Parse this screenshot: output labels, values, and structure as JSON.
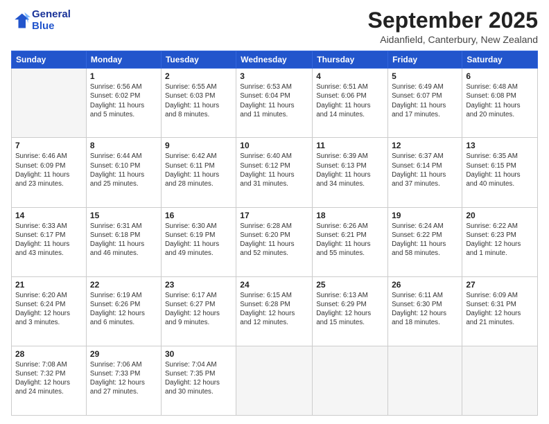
{
  "logo": {
    "line1": "General",
    "line2": "Blue"
  },
  "title": "September 2025",
  "location": "Aidanfield, Canterbury, New Zealand",
  "weekdays": [
    "Sunday",
    "Monday",
    "Tuesday",
    "Wednesday",
    "Thursday",
    "Friday",
    "Saturday"
  ],
  "weeks": [
    [
      {
        "day": "",
        "info": ""
      },
      {
        "day": "1",
        "info": "Sunrise: 6:56 AM\nSunset: 6:02 PM\nDaylight: 11 hours\nand 5 minutes."
      },
      {
        "day": "2",
        "info": "Sunrise: 6:55 AM\nSunset: 6:03 PM\nDaylight: 11 hours\nand 8 minutes."
      },
      {
        "day": "3",
        "info": "Sunrise: 6:53 AM\nSunset: 6:04 PM\nDaylight: 11 hours\nand 11 minutes."
      },
      {
        "day": "4",
        "info": "Sunrise: 6:51 AM\nSunset: 6:06 PM\nDaylight: 11 hours\nand 14 minutes."
      },
      {
        "day": "5",
        "info": "Sunrise: 6:49 AM\nSunset: 6:07 PM\nDaylight: 11 hours\nand 17 minutes."
      },
      {
        "day": "6",
        "info": "Sunrise: 6:48 AM\nSunset: 6:08 PM\nDaylight: 11 hours\nand 20 minutes."
      }
    ],
    [
      {
        "day": "7",
        "info": "Sunrise: 6:46 AM\nSunset: 6:09 PM\nDaylight: 11 hours\nand 23 minutes."
      },
      {
        "day": "8",
        "info": "Sunrise: 6:44 AM\nSunset: 6:10 PM\nDaylight: 11 hours\nand 25 minutes."
      },
      {
        "day": "9",
        "info": "Sunrise: 6:42 AM\nSunset: 6:11 PM\nDaylight: 11 hours\nand 28 minutes."
      },
      {
        "day": "10",
        "info": "Sunrise: 6:40 AM\nSunset: 6:12 PM\nDaylight: 11 hours\nand 31 minutes."
      },
      {
        "day": "11",
        "info": "Sunrise: 6:39 AM\nSunset: 6:13 PM\nDaylight: 11 hours\nand 34 minutes."
      },
      {
        "day": "12",
        "info": "Sunrise: 6:37 AM\nSunset: 6:14 PM\nDaylight: 11 hours\nand 37 minutes."
      },
      {
        "day": "13",
        "info": "Sunrise: 6:35 AM\nSunset: 6:15 PM\nDaylight: 11 hours\nand 40 minutes."
      }
    ],
    [
      {
        "day": "14",
        "info": "Sunrise: 6:33 AM\nSunset: 6:17 PM\nDaylight: 11 hours\nand 43 minutes."
      },
      {
        "day": "15",
        "info": "Sunrise: 6:31 AM\nSunset: 6:18 PM\nDaylight: 11 hours\nand 46 minutes."
      },
      {
        "day": "16",
        "info": "Sunrise: 6:30 AM\nSunset: 6:19 PM\nDaylight: 11 hours\nand 49 minutes."
      },
      {
        "day": "17",
        "info": "Sunrise: 6:28 AM\nSunset: 6:20 PM\nDaylight: 11 hours\nand 52 minutes."
      },
      {
        "day": "18",
        "info": "Sunrise: 6:26 AM\nSunset: 6:21 PM\nDaylight: 11 hours\nand 55 minutes."
      },
      {
        "day": "19",
        "info": "Sunrise: 6:24 AM\nSunset: 6:22 PM\nDaylight: 11 hours\nand 58 minutes."
      },
      {
        "day": "20",
        "info": "Sunrise: 6:22 AM\nSunset: 6:23 PM\nDaylight: 12 hours\nand 1 minute."
      }
    ],
    [
      {
        "day": "21",
        "info": "Sunrise: 6:20 AM\nSunset: 6:24 PM\nDaylight: 12 hours\nand 3 minutes."
      },
      {
        "day": "22",
        "info": "Sunrise: 6:19 AM\nSunset: 6:26 PM\nDaylight: 12 hours\nand 6 minutes."
      },
      {
        "day": "23",
        "info": "Sunrise: 6:17 AM\nSunset: 6:27 PM\nDaylight: 12 hours\nand 9 minutes."
      },
      {
        "day": "24",
        "info": "Sunrise: 6:15 AM\nSunset: 6:28 PM\nDaylight: 12 hours\nand 12 minutes."
      },
      {
        "day": "25",
        "info": "Sunrise: 6:13 AM\nSunset: 6:29 PM\nDaylight: 12 hours\nand 15 minutes."
      },
      {
        "day": "26",
        "info": "Sunrise: 6:11 AM\nSunset: 6:30 PM\nDaylight: 12 hours\nand 18 minutes."
      },
      {
        "day": "27",
        "info": "Sunrise: 6:09 AM\nSunset: 6:31 PM\nDaylight: 12 hours\nand 21 minutes."
      }
    ],
    [
      {
        "day": "28",
        "info": "Sunrise: 7:08 AM\nSunset: 7:32 PM\nDaylight: 12 hours\nand 24 minutes."
      },
      {
        "day": "29",
        "info": "Sunrise: 7:06 AM\nSunset: 7:33 PM\nDaylight: 12 hours\nand 27 minutes."
      },
      {
        "day": "30",
        "info": "Sunrise: 7:04 AM\nSunset: 7:35 PM\nDaylight: 12 hours\nand 30 minutes."
      },
      {
        "day": "",
        "info": ""
      },
      {
        "day": "",
        "info": ""
      },
      {
        "day": "",
        "info": ""
      },
      {
        "day": "",
        "info": ""
      }
    ]
  ]
}
